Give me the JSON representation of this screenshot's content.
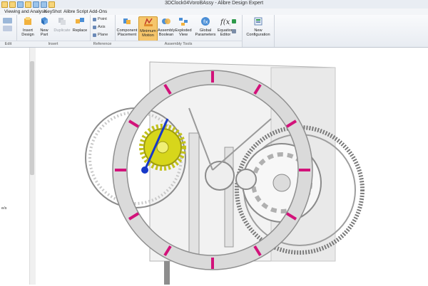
{
  "window": {
    "title": "3DClock04VoroBAssy - Alibre Design Expert"
  },
  "menu": [
    "Viewing and Analysis",
    "KeyShot",
    "Alibre Script",
    "Add-Ons"
  ],
  "ribbon": {
    "groups": {
      "edit": "Edit",
      "insert": "Insert",
      "reference": "Reference",
      "assembly_tools": "Assembly Tools"
    },
    "buttons": {
      "insert_design": "Insert\nDesign",
      "new_part": "New\nPart",
      "duplicate": "Duplicate",
      "replace": "Replace",
      "point": "Point",
      "axis": "Axis",
      "plane": "Plane",
      "component_placement": "Component\nPlacement",
      "minimum_motion": "Minimum\nMotion",
      "assembly_boolean": "Assembly\nBoolean",
      "exploded_view": "Exploded\nView",
      "global_parameters": "Global\nParameters",
      "equation_editor": "Equation\nEditor",
      "new_configuration": "New\nConfiguration"
    },
    "selected": "minimum_motion"
  },
  "left_panel": {
    "partial_text": "e/s"
  },
  "colors": {
    "accent": "#f6c66c",
    "clock_marker": "#d2127a",
    "gear_yellow": "#d7d61b",
    "clock_hand": "#1738c8"
  }
}
